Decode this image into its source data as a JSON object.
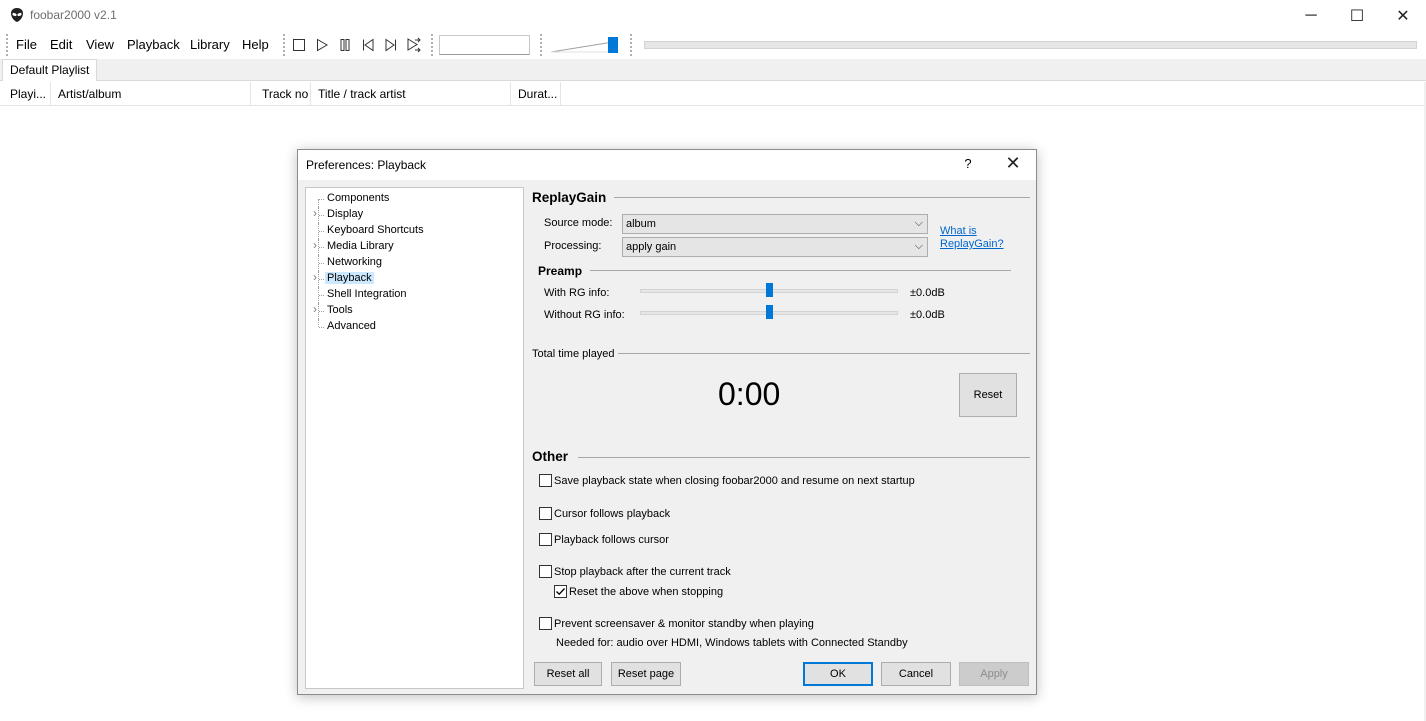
{
  "window": {
    "title": "foobar2000 v2.1",
    "minimize": "─",
    "maximize": "☐",
    "close": "✕"
  },
  "menu": {
    "file": "File",
    "edit": "Edit",
    "view": "View",
    "playback": "Playback",
    "library": "Library",
    "help": "Help"
  },
  "volume_level": 1.0,
  "playlist": {
    "tab": "Default Playlist",
    "columns": [
      "Playi...",
      "Artist/album",
      "Track no",
      "Title / track artist",
      "Durat..."
    ]
  },
  "dialog": {
    "title": "Preferences: Playback",
    "help": "?",
    "close": "✕",
    "tree": [
      {
        "label": "Components",
        "expandable": false,
        "selected": false
      },
      {
        "label": "Display",
        "expandable": true,
        "selected": false
      },
      {
        "label": "Keyboard Shortcuts",
        "expandable": false,
        "selected": false
      },
      {
        "label": "Media Library",
        "expandable": true,
        "selected": false
      },
      {
        "label": "Networking",
        "expandable": false,
        "selected": false
      },
      {
        "label": "Playback",
        "expandable": true,
        "selected": true
      },
      {
        "label": "Shell Integration",
        "expandable": false,
        "selected": false
      },
      {
        "label": "Tools",
        "expandable": true,
        "selected": false
      },
      {
        "label": "Advanced",
        "expandable": false,
        "selected": false
      }
    ],
    "replaygain": {
      "title": "ReplayGain",
      "source_mode_label": "Source mode:",
      "source_mode_value": "album",
      "processing_label": "Processing:",
      "processing_value": "apply gain",
      "link_line1": "What is",
      "link_line2": "ReplayGain?",
      "preamp_title": "Preamp",
      "with_rg_label": "With RG info:",
      "with_rg_value": "±0.0dB",
      "with_rg_level": 0.5,
      "without_rg_label": "Without RG info:",
      "without_rg_value": "±0.0dB",
      "without_rg_level": 0.5
    },
    "total_time": {
      "title": "Total time played",
      "value": "0:00",
      "reset": "Reset"
    },
    "other": {
      "title": "Other",
      "save_state": "Save playback state when closing foobar2000 and resume on next startup",
      "cursor_follows": "Cursor follows playback",
      "playback_follows": "Playback follows cursor",
      "stop_after": "Stop playback after the current track",
      "reset_above": "Reset the above when stopping",
      "prevent_screensaver": "Prevent screensaver & monitor standby when playing",
      "needed_for": "Needed for: audio over HDMI, Windows tablets with Connected Standby"
    },
    "buttons": {
      "reset_all": "Reset all",
      "reset_page": "Reset page",
      "ok": "OK",
      "cancel": "Cancel",
      "apply": "Apply"
    }
  }
}
